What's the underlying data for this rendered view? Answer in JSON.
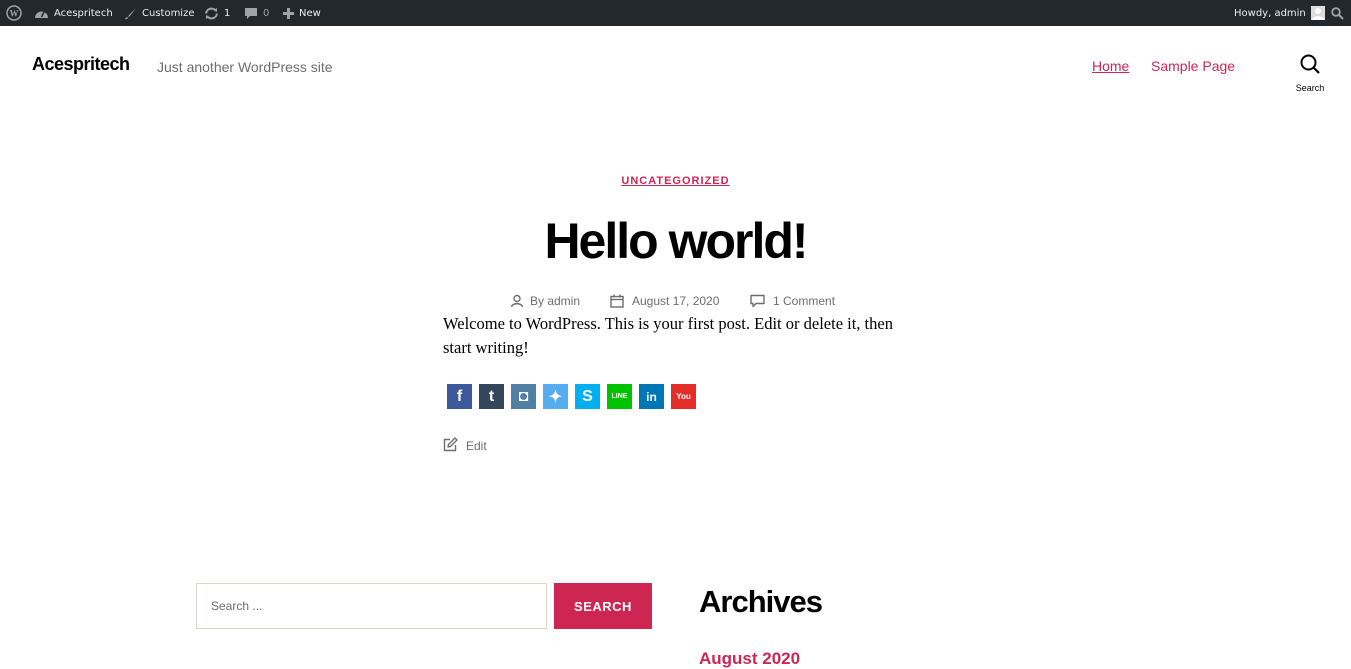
{
  "admin_bar": {
    "site_name": "Acespritech",
    "customize": "Customize",
    "updates_count": "1",
    "comments_count": "0",
    "new_label": "New",
    "howdy": "Howdy, admin"
  },
  "header": {
    "site_title": "Acespritech",
    "tagline": "Just another WordPress site",
    "nav": [
      {
        "label": "Home",
        "current": true
      },
      {
        "label": "Sample Page",
        "current": false
      }
    ],
    "search_label": "Search"
  },
  "post": {
    "category": "UNCATEGORIZED",
    "title": "Hello world!",
    "author": "By admin",
    "date": "August 17, 2020",
    "comments": "1 Comment",
    "body": "Welcome to WordPress. This is your first post. Edit or delete it, then start writing!",
    "edit_label": "Edit"
  },
  "share_icons": [
    {
      "icon": "facebook-icon",
      "glyph": "f",
      "color": "#3b5998"
    },
    {
      "icon": "tumblr-icon",
      "glyph": "t",
      "color": "#35465c"
    },
    {
      "icon": "instagram-icon",
      "glyph": "◘",
      "color": "#517fa4"
    },
    {
      "icon": "twitter-icon",
      "glyph": "✦",
      "color": "#55acee"
    },
    {
      "icon": "skype-icon",
      "glyph": "S",
      "color": "#00aff0"
    },
    {
      "icon": "line-icon",
      "glyph": "LINE",
      "color": "#00c300"
    },
    {
      "icon": "linkedin-icon",
      "glyph": "in",
      "color": "#0077b5"
    },
    {
      "icon": "youtube-icon",
      "glyph": "You",
      "color": "#e52d27"
    }
  ],
  "widgets": {
    "search_placeholder": "Search ...",
    "search_button": "SEARCH",
    "archives_title": "Archives",
    "archive_link": "August 2020"
  },
  "colors": {
    "accent": "#cd2653",
    "admin_bar_bg": "#23282d",
    "meta_text": "#6d6d6d"
  }
}
